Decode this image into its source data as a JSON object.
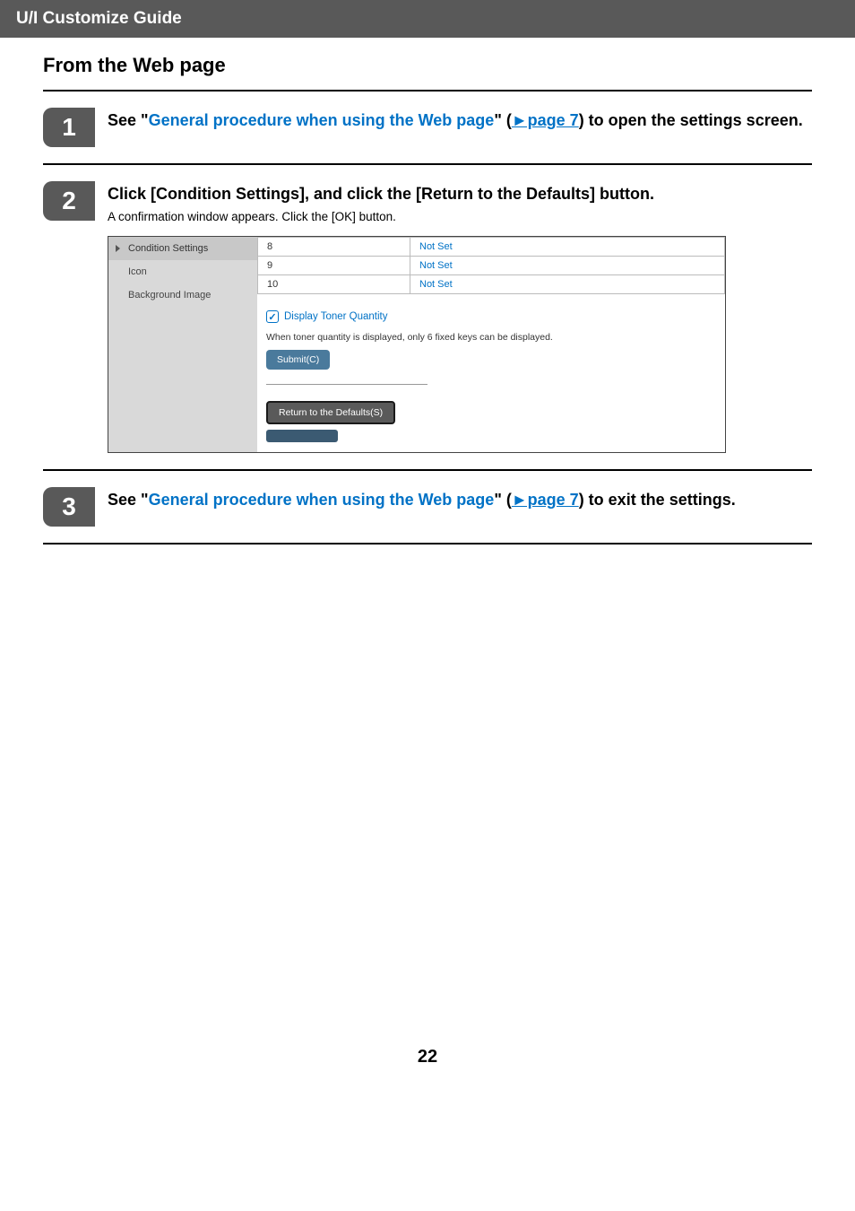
{
  "header": {
    "title": "U/I Customize Guide"
  },
  "heading": "From the Web page",
  "steps": {
    "s1": {
      "num": "1",
      "t_pre": "See \"",
      "t_link1": "General procedure when using the Web page",
      "t_mid": "\" (",
      "t_link2": "►page 7",
      "t_post": ") to open the settings screen."
    },
    "s2": {
      "num": "2",
      "title": "Click [Condition Settings], and click the [Return to the Defaults] button.",
      "sub": "A confirmation window appears. Click the [OK] button."
    },
    "s3": {
      "num": "3",
      "t_pre": "See \"",
      "t_link1": "General procedure when using the Web page",
      "t_mid": "\" (",
      "t_link2": "►page 7",
      "t_post": ") to exit the settings."
    }
  },
  "screenshot": {
    "side": {
      "condition": "Condition Settings",
      "icon": "Icon",
      "bg": "Background Image"
    },
    "rows": [
      {
        "n": "8",
        "v": "Not Set"
      },
      {
        "n": "9",
        "v": "Not Set"
      },
      {
        "n": "10",
        "v": "Not Set"
      }
    ],
    "checkbox_label": "Display Toner Quantity",
    "note": "When toner quantity is displayed, only 6 fixed keys can be displayed.",
    "submit": "Submit(C)",
    "defaults": "Return to the Defaults(S)"
  },
  "page_number": "22"
}
